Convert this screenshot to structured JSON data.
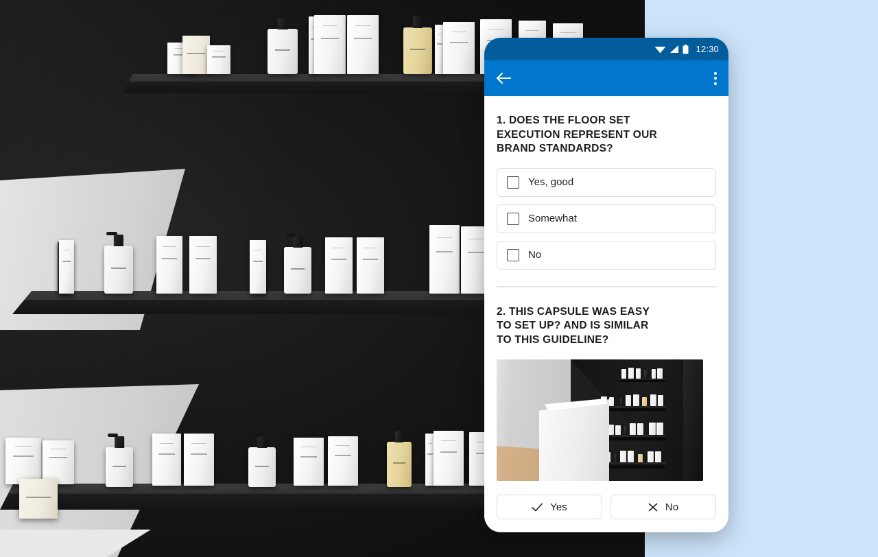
{
  "background": {
    "scene_name": "retail-floor-set-3d-render",
    "description": "Dark retail wall with three black shelves displaying white and cream cosmetic boxes and pump bottles, light gray angled wall panels at left",
    "wall_color": "#1b1b1b",
    "shelf_color": "#2e2e2e",
    "panel_color": "#d6d6d6",
    "accent_product_color": "#e5d49a"
  },
  "page": {
    "background_color": "#cce4fa"
  },
  "phone": {
    "statusbar": {
      "background_color": "#035c9c",
      "time": "12:30",
      "icons": [
        "wifi-icon",
        "signal-icon",
        "battery-icon"
      ]
    },
    "appbar": {
      "background_color": "#0077cc",
      "back_icon": "back-arrow-icon",
      "overflow_icon": "overflow-menu-icon"
    },
    "questions": [
      {
        "id": "q1",
        "title": "1. DOES THE FLOOR SET\nEXECUTION REPRESENT OUR\nBRAND STANDARDS?",
        "type": "checkbox-list",
        "options": [
          {
            "label": "Yes, good",
            "checked": false
          },
          {
            "label": "Somewhat",
            "checked": false
          },
          {
            "label": "No",
            "checked": false
          }
        ]
      },
      {
        "id": "q2",
        "title": "2. THIS CAPSULE WAS EASY\nTO SET UP? AND IS SIMILAR\nTO THIS GUIDELINE?",
        "type": "yes-no-with-image",
        "image": {
          "name": "guideline-reference-render",
          "description": "3D render of retail capsule: white counter at left, dark wall at right with four black shelves of white and cream product bottles, light wood floor"
        },
        "buttons": [
          {
            "label": "Yes",
            "icon": "check-icon"
          },
          {
            "label": "No",
            "icon": "close-icon"
          }
        ]
      }
    ]
  }
}
